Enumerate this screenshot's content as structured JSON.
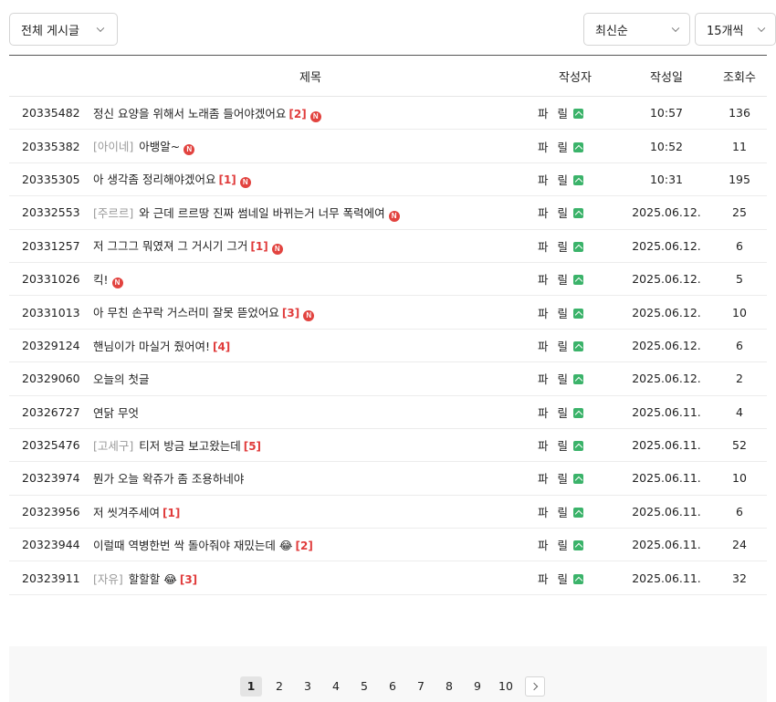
{
  "toolbar": {
    "board_filter": "전체 게시글",
    "sort": "최신순",
    "per_page": "15개씩"
  },
  "table": {
    "headers": {
      "title": "제목",
      "author": "작성자",
      "date": "작성일",
      "views": "조회수"
    },
    "rows": [
      {
        "num": "20335482",
        "category": "",
        "title": "정신 요양을 위해서 노래좀 들어야겠어요",
        "comments": "[2]",
        "is_new": true,
        "author": "파 릴",
        "date": "10:57",
        "views": "136"
      },
      {
        "num": "20335382",
        "category": "[아이네]",
        "title": "아뱅알~",
        "comments": "",
        "is_new": true,
        "author": "파 릴",
        "date": "10:52",
        "views": "11"
      },
      {
        "num": "20335305",
        "category": "",
        "title": "아 생각좀 정리해야겠어요",
        "comments": "[1]",
        "is_new": true,
        "author": "파 릴",
        "date": "10:31",
        "views": "195"
      },
      {
        "num": "20332553",
        "category": "[주르르]",
        "title": "와 근데 르르땅 진짜 썸네일 바뀌는거 너무 폭력에여",
        "comments": "",
        "is_new": true,
        "author": "파 릴",
        "date": "2025.06.12.",
        "views": "25"
      },
      {
        "num": "20331257",
        "category": "",
        "title": "저 그그그 뭐였져 그 거시기 그거",
        "comments": "[1]",
        "is_new": true,
        "author": "파 릴",
        "date": "2025.06.12.",
        "views": "6"
      },
      {
        "num": "20331026",
        "category": "",
        "title": "킥!",
        "comments": "",
        "is_new": true,
        "author": "파 릴",
        "date": "2025.06.12.",
        "views": "5"
      },
      {
        "num": "20331013",
        "category": "",
        "title": "아 무친 손꾸락 거스러미 잘못 뜯었어요",
        "comments": "[3]",
        "is_new": true,
        "author": "파 릴",
        "date": "2025.06.12.",
        "views": "10"
      },
      {
        "num": "20329124",
        "category": "",
        "title": "핸님이가 마실거 줬어여!",
        "comments": "[4]",
        "is_new": false,
        "author": "파 릴",
        "date": "2025.06.12.",
        "views": "6"
      },
      {
        "num": "20329060",
        "category": "",
        "title": "오늘의 첫글",
        "comments": "",
        "is_new": false,
        "author": "파 릴",
        "date": "2025.06.12.",
        "views": "2"
      },
      {
        "num": "20326727",
        "category": "",
        "title": "연닭 무엇",
        "comments": "",
        "is_new": false,
        "author": "파 릴",
        "date": "2025.06.11.",
        "views": "4"
      },
      {
        "num": "20325476",
        "category": "[고세구]",
        "title": "티저 방금 보고왔는데",
        "comments": "[5]",
        "is_new": false,
        "author": "파 릴",
        "date": "2025.06.11.",
        "views": "52"
      },
      {
        "num": "20323974",
        "category": "",
        "title": "뭔가 오늘 왁쥬가 좀 조용하네야",
        "comments": "",
        "is_new": false,
        "author": "파 릴",
        "date": "2025.06.11.",
        "views": "10"
      },
      {
        "num": "20323956",
        "category": "",
        "title": "저 씻겨주세여",
        "comments": "[1]",
        "is_new": false,
        "author": "파 릴",
        "date": "2025.06.11.",
        "views": "6"
      },
      {
        "num": "20323944",
        "category": "",
        "title": "이럴때 역병한번 싹 돌아줘야 재밌는데 😂",
        "comments": "[2]",
        "is_new": false,
        "author": "파 릴",
        "date": "2025.06.11.",
        "views": "24"
      },
      {
        "num": "20323911",
        "category": "[자유]",
        "title": "할할할 😂",
        "comments": "[3]",
        "is_new": false,
        "author": "파 릴",
        "date": "2025.06.11.",
        "views": "32"
      }
    ]
  },
  "new_badge": "N",
  "icons": {
    "level": "level-badge-icon",
    "new": "new-badge-icon",
    "next": "chevron-right-icon",
    "dropdown": "chevron-down-icon"
  },
  "colors": {
    "comment_count": "#e03b3b",
    "new_badge": "#e2433f",
    "level_badge": "#3bb36a",
    "category": "#9a9a9a"
  },
  "pagination": {
    "current": "1",
    "pages": [
      "1",
      "2",
      "3",
      "4",
      "5",
      "6",
      "7",
      "8",
      "9",
      "10"
    ]
  }
}
